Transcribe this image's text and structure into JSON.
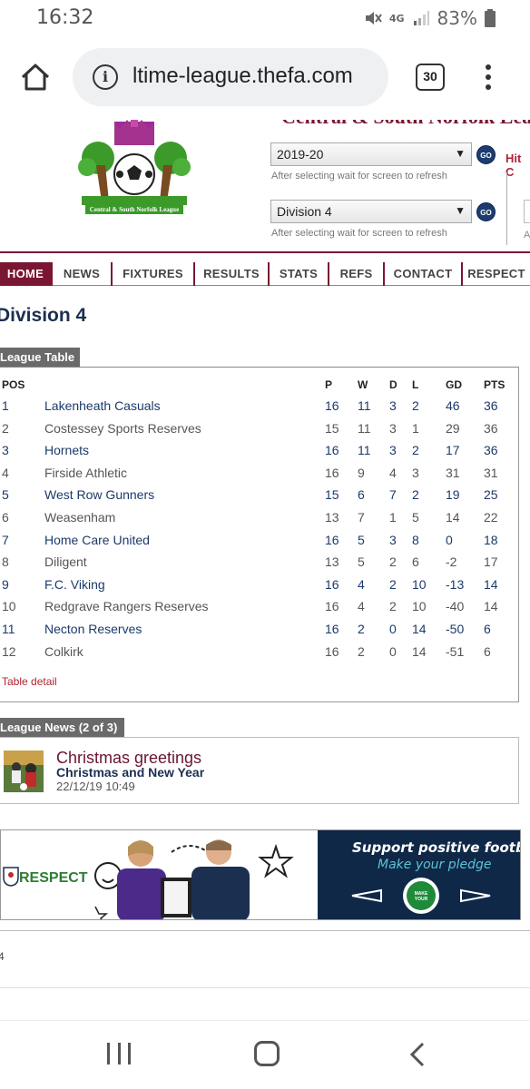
{
  "status_bar": {
    "time": "16:32",
    "network": "4G",
    "battery": "83%"
  },
  "browser": {
    "url": "ltime-league.thefa.com",
    "tab_count": "30"
  },
  "site": {
    "league_title": "Central & South Norfolk League",
    "season_select": "2019-20",
    "division_select": "Division 4",
    "go_label": "GO",
    "hint": "After selecting wait for screen to refresh",
    "hit_counter_label": "Hit C",
    "ghost_text": "A"
  },
  "nav": {
    "items": [
      "HOME",
      "NEWS",
      "FIXTURES",
      "RESULTS",
      "STATS",
      "REFS",
      "CONTACT",
      "RESPECT"
    ]
  },
  "division_title": "Division 4",
  "league_table": {
    "section_label": "League Table",
    "headers": [
      "POS",
      "P",
      "W",
      "D",
      "L",
      "GD",
      "PTS"
    ],
    "rows": [
      [
        "1",
        "Lakenheath Casuals",
        "16",
        "11",
        "3",
        "2",
        "46",
        "36"
      ],
      [
        "2",
        "Costessey Sports Reserves",
        "15",
        "11",
        "3",
        "1",
        "29",
        "36"
      ],
      [
        "3",
        "Hornets",
        "16",
        "11",
        "3",
        "2",
        "17",
        "36"
      ],
      [
        "4",
        "Firside Athletic",
        "16",
        "9",
        "4",
        "3",
        "31",
        "31"
      ],
      [
        "5",
        "West Row Gunners",
        "15",
        "6",
        "7",
        "2",
        "19",
        "25"
      ],
      [
        "6",
        "Weasenham",
        "13",
        "7",
        "1",
        "5",
        "14",
        "22"
      ],
      [
        "7",
        "Home Care United",
        "16",
        "5",
        "3",
        "8",
        "0",
        "18"
      ],
      [
        "8",
        "Diligent",
        "13",
        "5",
        "2",
        "6",
        "-2",
        "17"
      ],
      [
        "9",
        "F.C. Viking",
        "16",
        "4",
        "2",
        "10",
        "-13",
        "14"
      ],
      [
        "10",
        "Redgrave Rangers Reserves",
        "16",
        "4",
        "2",
        "10",
        "-40",
        "14"
      ],
      [
        "11",
        "Necton Reserves",
        "16",
        "2",
        "0",
        "14",
        "-50",
        "6"
      ],
      [
        "12",
        "Colkirk",
        "16",
        "2",
        "0",
        "14",
        "-51",
        "6"
      ]
    ],
    "detail_link": "Table detail"
  },
  "league_news": {
    "section_label": "League News (2 of 3)",
    "title": "Christmas greetings",
    "subtitle": "Christmas and New Year",
    "date": "22/12/19 10:49"
  },
  "banner": {
    "respect": "RESPECT",
    "line1": "Support positive football",
    "line2": "Make your pledge"
  },
  "footer": {
    "fragment": "4"
  },
  "colors": {
    "brand": "#7a1631",
    "link": "#1b3a6a",
    "go_button": "#1e3c70"
  }
}
